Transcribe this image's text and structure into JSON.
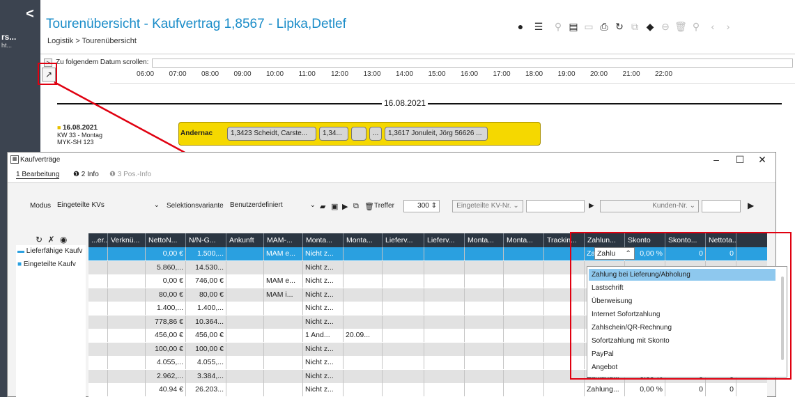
{
  "left": {
    "back": "<",
    "text1": "rs...",
    "text2": "ht..."
  },
  "header": {
    "title": "Tourenübersicht - Kaufvertrag 1,8567 - Lipka,Detlef",
    "breadcrumb": "Logistik  >  Tourenübersicht"
  },
  "scroll": {
    "button": ">",
    "label": "Zu folgendem Datum scrollen:"
  },
  "timeline": {
    "hours": [
      "06:00",
      "07:00",
      "08:00",
      "09:00",
      "10:00",
      "11:00",
      "12:00",
      "13:00",
      "14:00",
      "15:00",
      "16:00",
      "17:00",
      "18:00",
      "19:00",
      "20:00",
      "21:00",
      "22:00"
    ],
    "date": "16.08.2021"
  },
  "vehicle": {
    "date": "16.08.2021",
    "week": "KW 33 - Montag",
    "plate": "MYK-SH 123"
  },
  "truck": {
    "start": "Andernac",
    "stops": [
      "1,3423 Scheidt, Carste...",
      "1,34...",
      "",
      "...",
      "1,3617 Jonuleit, Jörg 56626 ..."
    ]
  },
  "dialog": {
    "title": "Kaufverträge",
    "tabs": [
      "1 Bearbeitung",
      "2 Info",
      "3 Pos.-Info"
    ],
    "filter": {
      "modus_label": "Modus",
      "modus_value": "Eingeteilte KVs",
      "sel_label": "Selektionsvariante",
      "sel_value": "Benutzerdefiniert",
      "treffer_label": "Treffer",
      "treffer_value": "300",
      "kv_btn": "Eingeteilte KV-Nr.",
      "kunden_btn": "Kunden-Nr."
    },
    "tree": [
      "Lieferfähige Kaufv",
      "Eingeteilte Kaufv"
    ],
    "columns": [
      "...er...",
      "Verknü...",
      "NettoN...",
      "N/N-G...",
      "Ankunft",
      "MAM-...",
      "Monta...",
      "Monta...",
      "Lieferv...",
      "Lieferv...",
      "Monta...",
      "Monta...",
      "Trackin...",
      "Zahlun...",
      "Skonto",
      "Skonto...",
      "Nettota..."
    ],
    "rows": [
      [
        "",
        "",
        "0,00 €",
        "1.500,...",
        "",
        "MAM e...",
        "Nicht z...",
        "",
        "",
        "",
        "",
        "",
        "",
        "Zahlu",
        "0,00 %",
        "0",
        "0"
      ],
      [
        "",
        "",
        "5.860,...",
        "14.530...",
        "",
        "",
        "Nicht z...",
        "",
        "",
        "",
        "",
        "",
        "",
        "",
        "",
        "",
        ""
      ],
      [
        "",
        "",
        "0,00 €",
        "746,00 €",
        "",
        "MAM e...",
        "Nicht z...",
        "",
        "",
        "",
        "",
        "",
        "",
        "",
        "",
        "",
        ""
      ],
      [
        "",
        "",
        "80,00 €",
        "80,00 €",
        "",
        "MAM i...",
        "Nicht z...",
        "",
        "",
        "",
        "",
        "",
        "",
        "",
        "",
        "",
        ""
      ],
      [
        "",
        "",
        "1.400,...",
        "1.400,...",
        "",
        "",
        "Nicht z...",
        "",
        "",
        "",
        "",
        "",
        "",
        "",
        "",
        "",
        ""
      ],
      [
        "",
        "",
        "778,86 €",
        "10.364...",
        "",
        "",
        "Nicht z...",
        "",
        "",
        "",
        "",
        "",
        "",
        "",
        "",
        "",
        ""
      ],
      [
        "",
        "",
        "456,00 €",
        "456,00 €",
        "",
        "",
        "1 And...",
        "20.09...",
        "",
        "",
        "",
        "",
        "",
        "",
        "",
        "",
        ""
      ],
      [
        "",
        "",
        "100,00 €",
        "100,00 €",
        "",
        "",
        "Nicht z...",
        "",
        "",
        "",
        "",
        "",
        "",
        "",
        "",
        "",
        ""
      ],
      [
        "",
        "",
        "4.055,...",
        "4.055,...",
        "",
        "",
        "Nicht z...",
        "",
        "",
        "",
        "",
        "",
        "",
        "",
        "",
        "",
        ""
      ],
      [
        "",
        "",
        "2.962,...",
        "3.384,...",
        "",
        "",
        "Nicht z...",
        "",
        "",
        "",
        "",
        "",
        "",
        "Zahlung...",
        "0,00 %",
        "0",
        "0"
      ],
      [
        "",
        "",
        "40.94 €",
        "26.203...",
        "",
        "",
        "Nicht z...",
        "",
        "",
        "",
        "",
        "",
        "",
        "Zahlung...",
        "0,00 %",
        "0",
        "0"
      ]
    ],
    "dropdown": [
      "Zahlung bei Lieferung/Abholung",
      "Lastschrift",
      "Überweisung",
      "Internet Sofortzahlung",
      "Zahlschein/QR-Rechnung",
      "Sofortzahlung mit Skonto",
      "PayPal",
      "Angebot"
    ]
  },
  "colors": {
    "accent": "#1a8cc8",
    "header": "#2b3642",
    "selection": "#2aa0e0",
    "highlight": "#e00010",
    "truck": "#f5d800"
  }
}
